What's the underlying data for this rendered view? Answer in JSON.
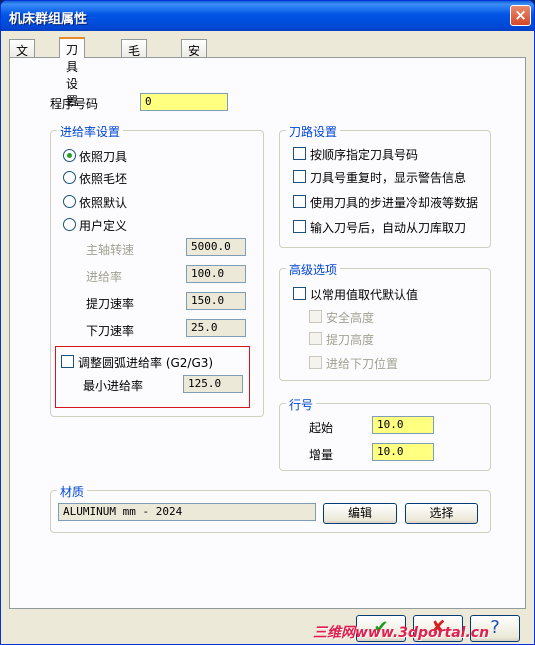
{
  "window": {
    "title": "机床群组属性",
    "close_label": "×"
  },
  "tabs": [
    {
      "label": "文件",
      "active": false
    },
    {
      "label": "刀具设置",
      "active": true
    },
    {
      "label": "毛坯设置",
      "active": false
    },
    {
      "label": "安全区域",
      "active": false
    }
  ],
  "program_number": {
    "label": "程序号码",
    "value": "0"
  },
  "feed_settings": {
    "title": "进给率设置",
    "options": [
      {
        "label": "依照刀具",
        "selected": true
      },
      {
        "label": "依照毛坯",
        "selected": false
      },
      {
        "label": "依照默认",
        "selected": false
      },
      {
        "label": "用户定义",
        "selected": false
      }
    ],
    "fields": [
      {
        "label": "主轴转速",
        "value": "5000.0"
      },
      {
        "label": "进给率",
        "value": "100.0"
      },
      {
        "label": "提刀速率",
        "value": "150.0"
      },
      {
        "label": "下刀速率",
        "value": "25.0"
      }
    ],
    "arc_feed": {
      "label": "调整圆弧进给率 (G2/G3)",
      "checked": false
    },
    "min_feed": {
      "label": "最小进给率",
      "value": "125.0"
    }
  },
  "toolpath_settings": {
    "title": "刀路设置",
    "options": [
      {
        "label": "按顺序指定刀具号码",
        "checked": false
      },
      {
        "label": "刀具号重复时，显示警告信息",
        "checked": false
      },
      {
        "label": "使用刀具的步进量冷却液等数据",
        "checked": false
      },
      {
        "label": "输入刀号后，自动从刀库取刀",
        "checked": false
      }
    ]
  },
  "advanced": {
    "title": "高级选项",
    "override": {
      "label": "以常用值取代默认值",
      "checked": false
    },
    "options": [
      {
        "label": "安全高度"
      },
      {
        "label": "提刀高度"
      },
      {
        "label": "进给下刀位置"
      }
    ]
  },
  "line_number": {
    "title": "行号",
    "start": {
      "label": "起始",
      "value": "10.0"
    },
    "increment": {
      "label": "增量",
      "value": "10.0"
    }
  },
  "material": {
    "title": "材质",
    "value": "ALUMINUM mm - 2024",
    "edit_label": "编辑",
    "select_label": "选择"
  },
  "footer": {
    "ok_icon": "✔",
    "cancel_icon": "✘",
    "help_icon": "?",
    "watermark": "三维网www.3dportal.cn"
  },
  "colors": {
    "title_bar": "#0055e5",
    "highlight_field": "#ffff80",
    "group_title": "#0046d5",
    "red_box": "#d8141e"
  }
}
